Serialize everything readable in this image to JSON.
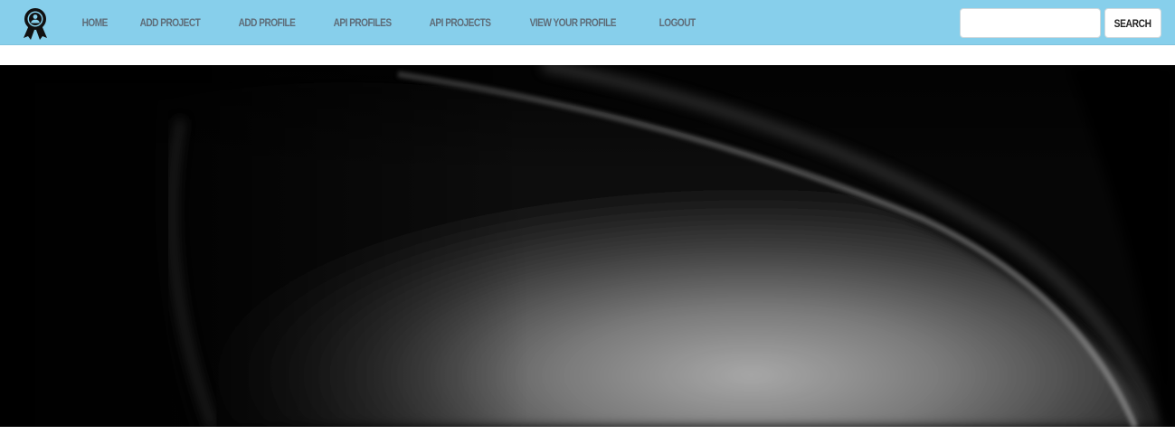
{
  "navbar": {
    "brand_icon": "award-ribbon-icon",
    "background_color": "#87cfeb",
    "link_color": "#5e6c78",
    "links": [
      {
        "label": "Home"
      },
      {
        "label": "Add Project"
      },
      {
        "label": "Add Profile"
      },
      {
        "label": "API Profiles"
      },
      {
        "label": "API Projects"
      },
      {
        "label": "View Your Profile"
      },
      {
        "label": "Logout"
      }
    ]
  },
  "search": {
    "placeholder": "",
    "value": "",
    "button_label": "Search"
  },
  "hero": {
    "image": "dark-gray-abstract-curve-background"
  }
}
